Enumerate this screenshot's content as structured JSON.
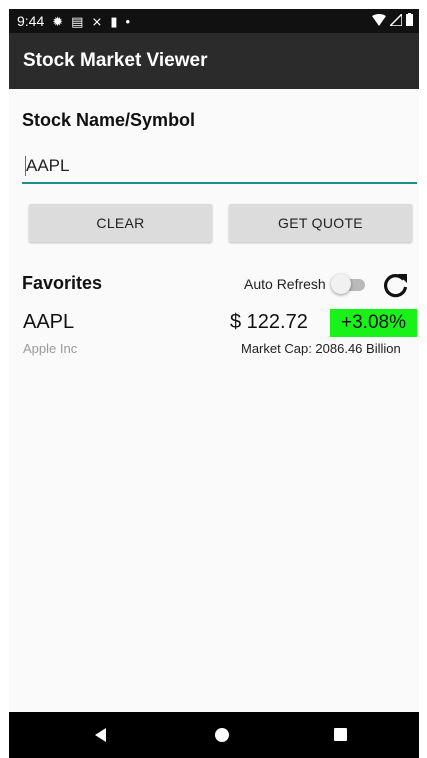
{
  "status_bar": {
    "time": "9:44",
    "icons": [
      "gear-icon",
      "message-icon",
      "usb-icon",
      "sd-card-icon",
      "dot-icon"
    ],
    "right_icons": [
      "wifi-icon",
      "signal-icon",
      "battery-icon"
    ]
  },
  "app_bar": {
    "title": "Stock Market Viewer"
  },
  "search": {
    "label": "Stock Name/Symbol",
    "value": "AAPL"
  },
  "buttons": {
    "clear": "CLEAR",
    "get_quote": "GET QUOTE"
  },
  "favorites": {
    "title": "Favorites",
    "auto_refresh_label": "Auto Refresh",
    "auto_refresh_on": false,
    "items": [
      {
        "symbol": "AAPL",
        "name": "Apple Inc",
        "price": "$ 122.72",
        "change": "+3.08%",
        "market_cap": "Market Cap: 2086.46 Billion"
      }
    ]
  },
  "colors": {
    "accent": "#1a8f86",
    "change_positive": "#19f219",
    "app_bar": "#2b2b2b"
  }
}
